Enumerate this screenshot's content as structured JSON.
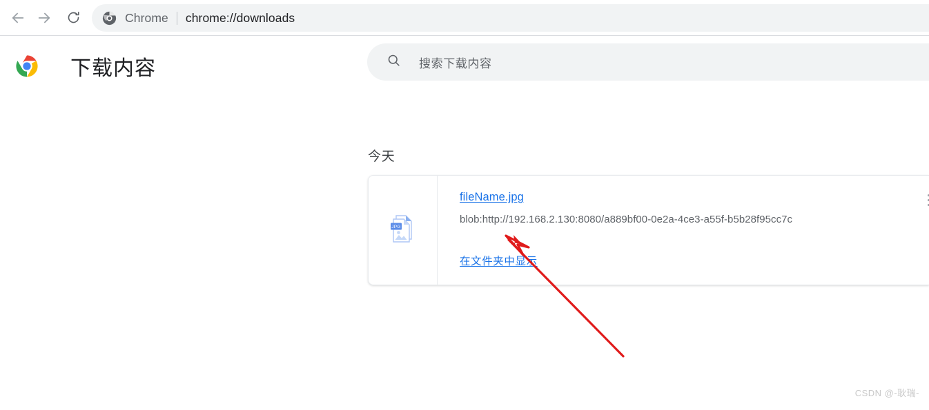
{
  "browser": {
    "back_icon": "arrow-left-icon",
    "forward_icon": "arrow-right-icon",
    "reload_icon": "reload-icon",
    "omnibox": {
      "favicon": "chrome-favicon",
      "scheme_label": "Chrome",
      "separator": "|",
      "url": "chrome://downloads"
    }
  },
  "page": {
    "logo": "chrome-logo",
    "title": "下载内容",
    "search": {
      "icon": "search-icon",
      "placeholder": "搜索下载内容",
      "value": ""
    },
    "groups": [
      {
        "label": "今天",
        "items": [
          {
            "file_icon": "jpg-file-icon",
            "file_icon_label": "JPG",
            "file_name": "fileName.jpg",
            "source_url": "blob:http://192.168.2.130:8080/a889bf00-0e2a-4ce3-a55f-b5b28f95cc7c",
            "action_label": "在文件夹中显示",
            "menu_icon": "more-vertical-icon"
          }
        ]
      }
    ]
  },
  "annotation": {
    "arrow_color": "#e01b1b",
    "arrow_from": "903,516",
    "arrow_to": "732,342"
  },
  "watermark": "CSDN @-耿瑞-",
  "colors": {
    "link": "#1a73e8",
    "text_primary": "#202124",
    "text_secondary": "#5f6368",
    "field_bg": "#f1f3f4",
    "border": "#e8eaed",
    "annotation_red": "#e01b1b"
  }
}
